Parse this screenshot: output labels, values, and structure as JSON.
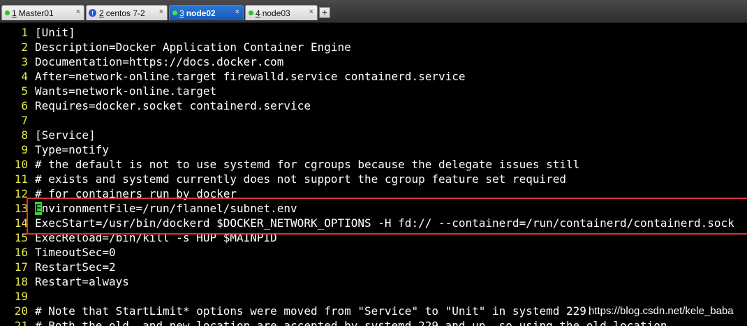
{
  "tabs": [
    {
      "num": "1",
      "label": "Master01",
      "status": "connected",
      "active": false
    },
    {
      "num": "2",
      "label": "centos 7-2",
      "status": "warning",
      "active": false
    },
    {
      "num": "3",
      "label": "node02",
      "status": "connected",
      "active": true
    },
    {
      "num": "4",
      "label": "node03",
      "status": "connected",
      "active": false
    }
  ],
  "new_tab_label": "+",
  "close_glyph": "×",
  "warning_glyph": "!",
  "lines": [
    {
      "n": "1",
      "text": "[Unit]"
    },
    {
      "n": "2",
      "text": "Description=Docker Application Container Engine"
    },
    {
      "n": "3",
      "text": "Documentation=https://docs.docker.com"
    },
    {
      "n": "4",
      "text": "After=network-online.target firewalld.service containerd.service"
    },
    {
      "n": "5",
      "text": "Wants=network-online.target"
    },
    {
      "n": "6",
      "text": "Requires=docker.socket containerd.service"
    },
    {
      "n": "7",
      "text": ""
    },
    {
      "n": "8",
      "text": "[Service]"
    },
    {
      "n": "9",
      "text": "Type=notify"
    },
    {
      "n": "10",
      "text": "# the default is not to use systemd for cgroups because the delegate issues still"
    },
    {
      "n": "11",
      "text": "# exists and systemd currently does not support the cgroup feature set required"
    },
    {
      "n": "12",
      "text": "# for containers run by docker"
    },
    {
      "n": "13",
      "cursor_char": "E",
      "text": "nvironmentFile=/run/flannel/subnet.env"
    },
    {
      "n": "14",
      "text": "ExecStart=/usr/bin/dockerd $DOCKER_NETWORK_OPTIONS -H fd:// --containerd=/run/containerd/containerd.sock"
    },
    {
      "n": "15",
      "text": "ExecReload=/bin/kill -s HUP $MAINPID"
    },
    {
      "n": "16",
      "text": "TimeoutSec=0"
    },
    {
      "n": "17",
      "text": "RestartSec=2"
    },
    {
      "n": "18",
      "text": "Restart=always"
    },
    {
      "n": "19",
      "text": ""
    },
    {
      "n": "20",
      "text": "# Note that StartLimit* options were moved from \"Service\" to \"Unit\" in systemd 229."
    },
    {
      "n": "21",
      "text": "# Both the old, and new location are accepted by systemd 229 and up, so using the old location"
    }
  ],
  "watermark": "https://blog.csdn.net/kele_baba",
  "colors": {
    "background": "#000000",
    "text": "#ffffff",
    "line_numbers": "#e8e850",
    "cursor": "#33d633",
    "highlight_border": "#e0303a",
    "active_tab": "#1f6bd0"
  }
}
